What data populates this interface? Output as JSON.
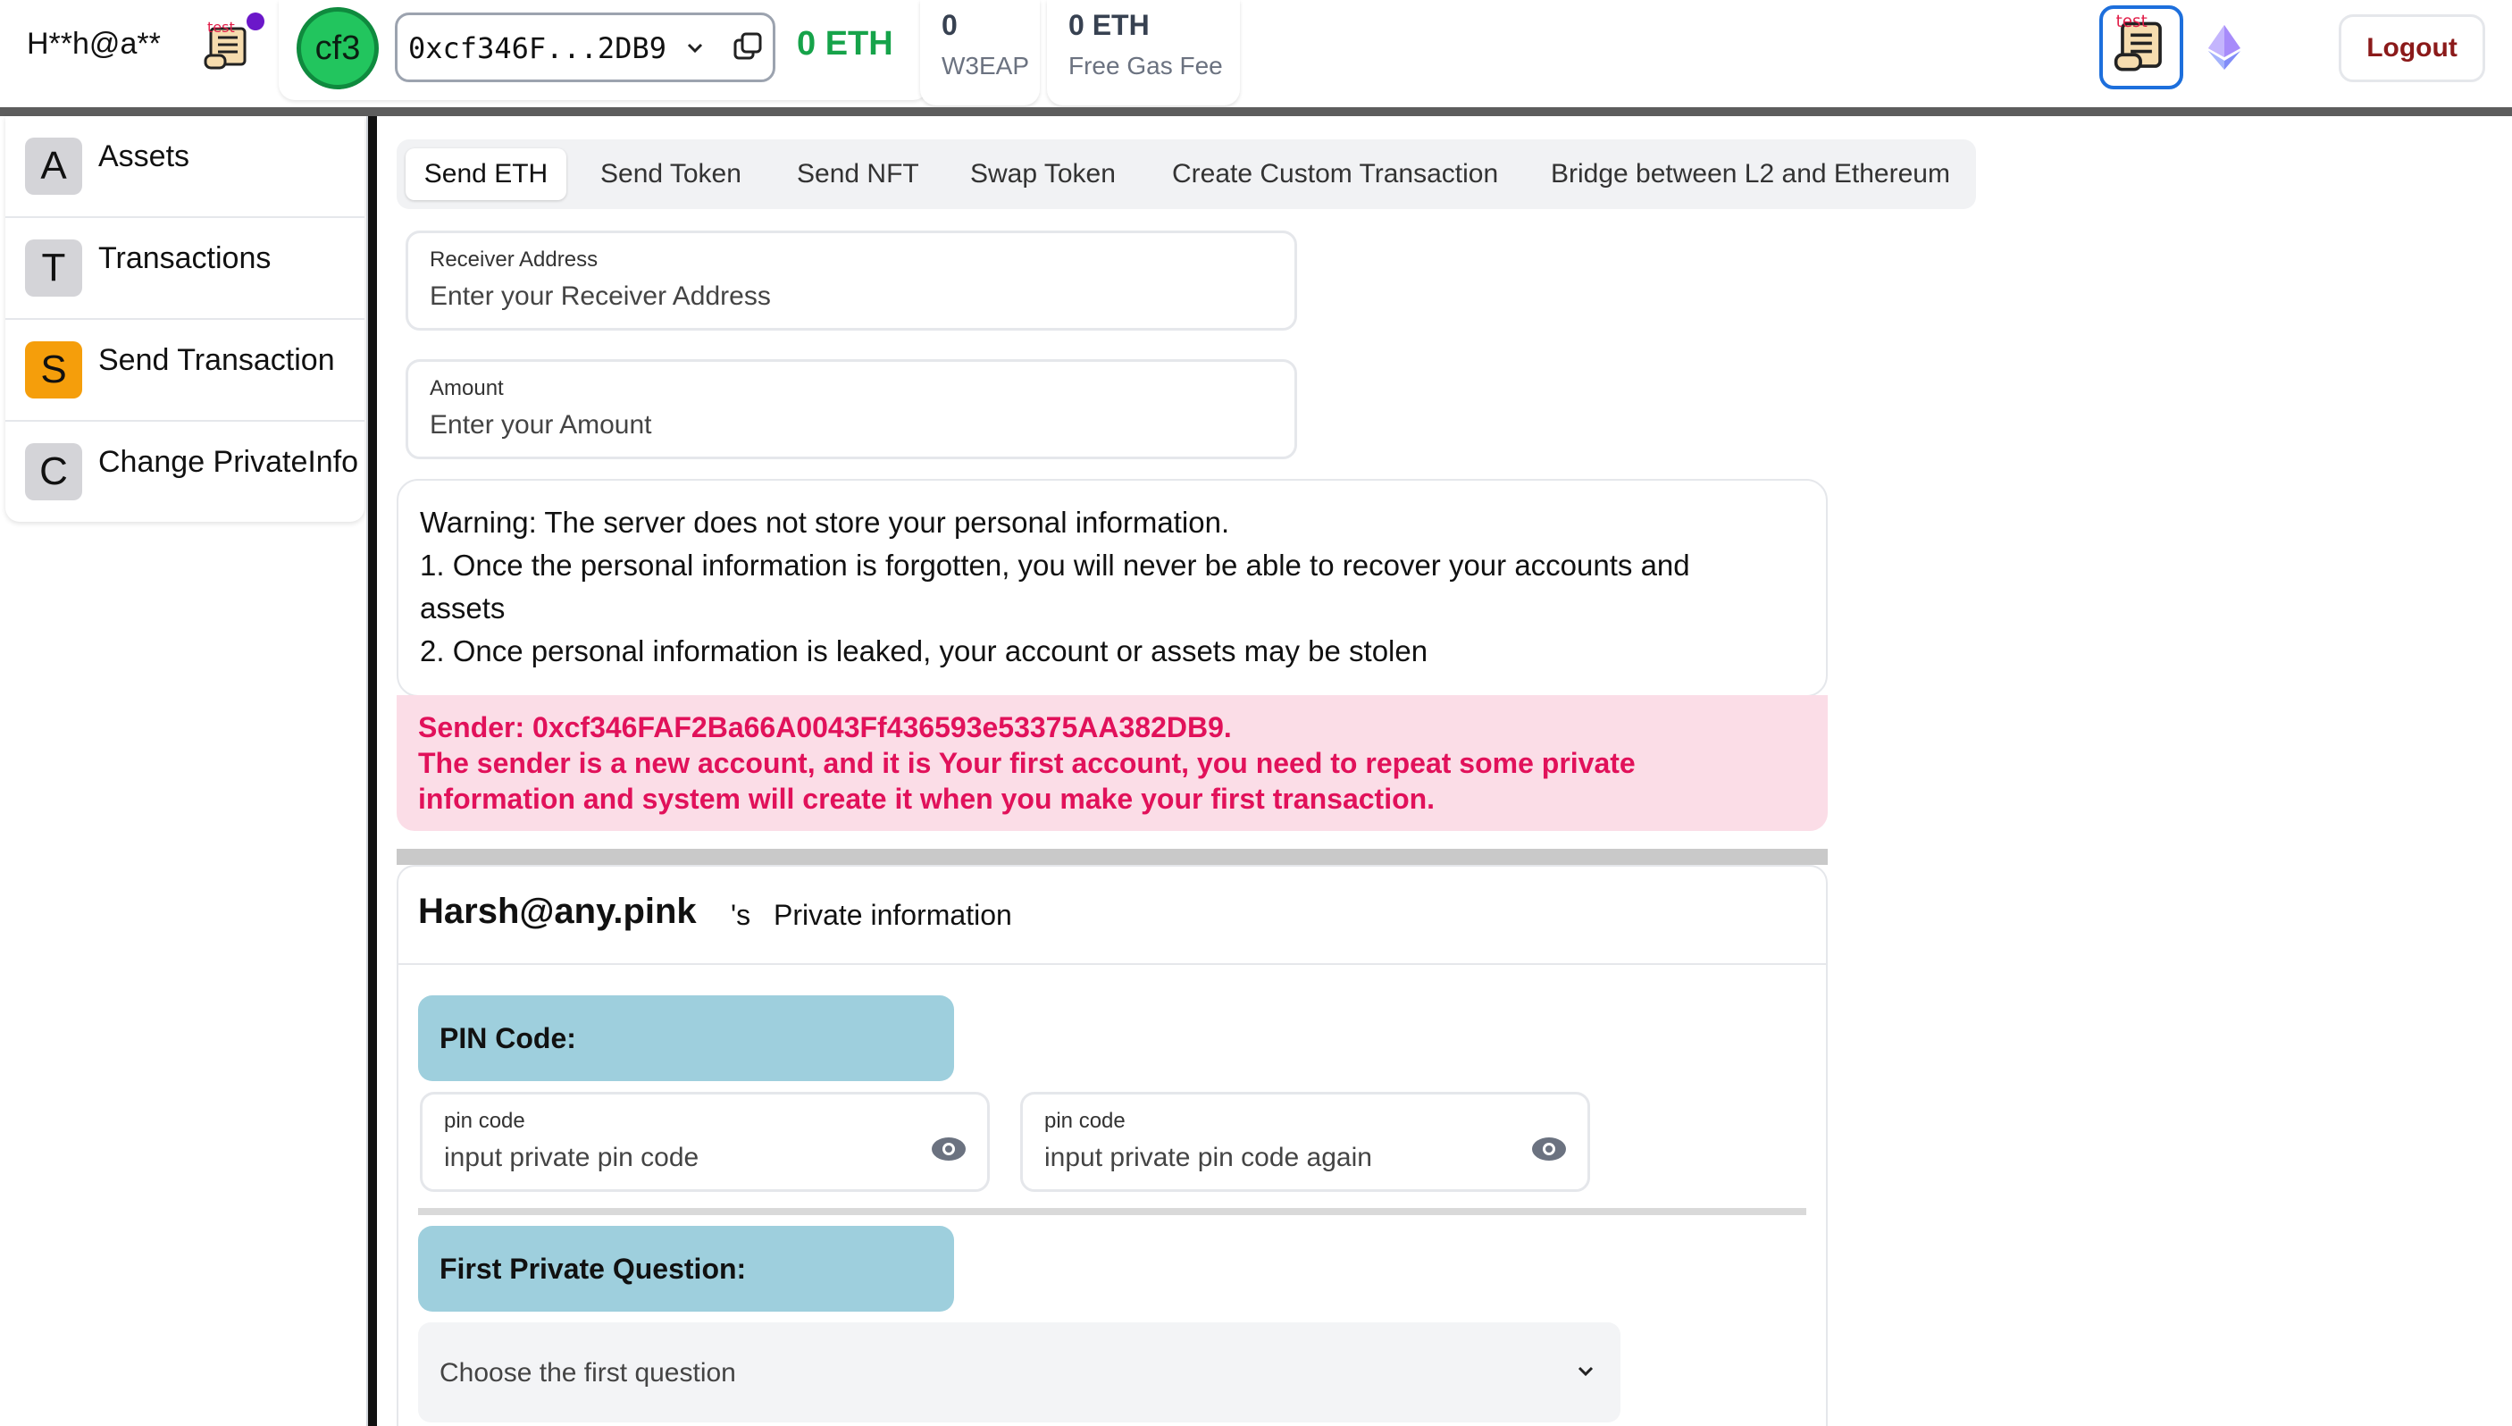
{
  "header": {
    "user_masked": "H**h@a**",
    "scroll_icon_text": "test",
    "avatar_text": "cf3",
    "address_short": "0xcf346F...2DB9",
    "eth_balance": "0 ETH",
    "stats": [
      {
        "value": "0",
        "label": "W3EAP"
      },
      {
        "value": "0 ETH",
        "label": "Free Gas Fee"
      }
    ],
    "logout_label": "Logout"
  },
  "sidebar": {
    "items": [
      {
        "letter": "A",
        "label": "Assets",
        "active": false
      },
      {
        "letter": "T",
        "label": "Transactions",
        "active": false
      },
      {
        "letter": "S",
        "label": "Send Transaction",
        "active": true
      },
      {
        "letter": "C",
        "label": "Change PrivateInfo",
        "active": false
      }
    ]
  },
  "main": {
    "tabs": [
      {
        "label": "Send ETH",
        "active": true
      },
      {
        "label": "Send Token",
        "active": false
      },
      {
        "label": "Send NFT",
        "active": false
      },
      {
        "label": "Swap Token",
        "active": false
      },
      {
        "label": "Create Custom Transaction",
        "active": false
      },
      {
        "label": "Bridge between L2 and Ethereum",
        "active": false
      }
    ],
    "receiver": {
      "label": "Receiver Address",
      "placeholder": "Enter your Receiver Address"
    },
    "amount": {
      "label": "Amount",
      "placeholder": "Enter your Amount"
    },
    "warning": {
      "lines": [
        "Warning: The server does not store your personal information.",
        "1. Once the personal information is forgotten, you will never be able to recover your accounts and",
        "assets",
        "2. Once personal information is leaked, your account or assets may be stolen"
      ]
    },
    "alert": {
      "lines": [
        "Sender: 0xcf346FAF2Ba66A0043Ff436593e53375AA382DB9.",
        "The sender is a new account, and it is Your first account, you need to repeat some private",
        "information and system will create it when you make your first transaction."
      ]
    },
    "private_info": {
      "email": "Harsh@any.pink",
      "apostrophe": "'s",
      "title": "Private information",
      "pin_section": "PIN Code:",
      "pin1": {
        "label": "pin code",
        "placeholder": "input private pin code"
      },
      "pin2": {
        "label": "pin code",
        "placeholder": "input private pin code again"
      },
      "question_section": "First Private Question:",
      "question_select": "Choose the first question"
    }
  },
  "colors": {
    "accent_green": "#16a34a",
    "alert_pink": "#e1115a",
    "alert_bg": "#fbdde7",
    "section_blue": "#9ecfdd",
    "active_orange": "#f59e0b",
    "logout_red": "#8b1a1a"
  }
}
